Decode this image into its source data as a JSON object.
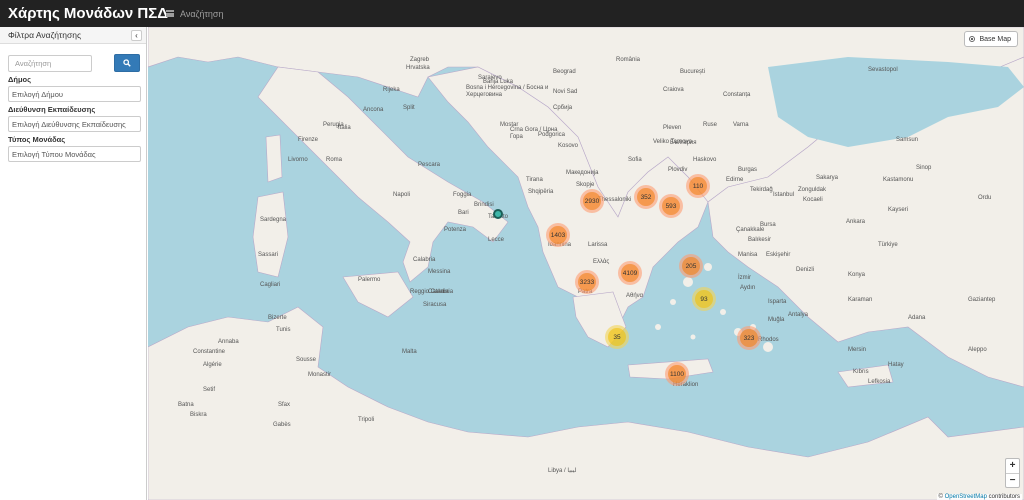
{
  "app": {
    "title": "Χάρτης Μονάδων ΠΣΔ",
    "nav_search": "Αναζήτηση"
  },
  "sidebar": {
    "header": "Φίλτρα Αναζήτησης",
    "search_placeholder": "Αναζήτηση",
    "filters": [
      {
        "label": "Δήμος",
        "value": "Επιλογή Δήμου"
      },
      {
        "label": "Διεύθυνση Εκπαίδευσης",
        "value": "Επιλογή Διεύθυνσης Εκπαίδευσης"
      },
      {
        "label": "Τύπος Μονάδας",
        "value": "Επιλογή Τύπου Μονάδας"
      }
    ]
  },
  "map": {
    "basemap_label": "Base Map",
    "attribution_prefix": "© ",
    "attribution_link": "OpenStreetMap",
    "attribution_suffix": " contributors",
    "zoom_in": "+",
    "zoom_out": "−",
    "clusters": [
      "2930",
      "352",
      "593",
      "110",
      "1403",
      "4109",
      "205",
      "3233",
      "93",
      "35",
      "323",
      "1100"
    ],
    "labels": [
      "Hrvatska",
      "Bosna i Hercegovina / Босна и Херцеговина",
      "Србија",
      "Crna Gora / Црна Гора",
      "Kosovo",
      "Shqipëria",
      "Македонија",
      "България",
      "București",
      "Sevastopol",
      "România",
      "Istanbul",
      "Türkiye",
      "Ankara",
      "Ελλάς",
      "Αθήνα",
      "Italia",
      "Napoli",
      "Roma",
      "Palermo",
      "Malta",
      "Tunis",
      "Algérie",
      "Libya / ليبيا",
      "Tripoli",
      "Kıbrıs",
      "Beograd",
      "Sarajevo",
      "Zagreb",
      "Bari",
      "Brindisi",
      "Taranto",
      "Potenza",
      "Bursa",
      "İzmir",
      "Konya",
      "Kayseri",
      "Antalya",
      "Isparta",
      "Sofia",
      "Skopje",
      "Tirana",
      "Plovdiv",
      "Varna",
      "Burgas",
      "Tekirdağ",
      "Samsun",
      "Ordu",
      "Sinop",
      "Kastamonu",
      "Sakarya",
      "Zonguldak",
      "Kocaeli",
      "Eskişehir",
      "Aydın",
      "Adana",
      "Gaziantep",
      "Sfax",
      "Sousse",
      "Monastir",
      "Constantine",
      "Annaba",
      "Setif",
      "Biskra",
      "Batna",
      "Bizerte",
      "Gabès",
      "Sardegna",
      "Cagliari",
      "Sassari",
      "Calabria",
      "Reggio Calabria",
      "Catania",
      "Messina",
      "Siracusa",
      "Lecce",
      "Foggia",
      "Pescara",
      "Ancona",
      "Perugia",
      "Firenze",
      "Livorno",
      "Split",
      "Rijeka",
      "Banja Luka",
      "Mostar",
      "Podgorica",
      "Thessaloniki",
      "Larissa",
      "Patra",
      "Ioannina",
      "Heraklion",
      "Rhodos",
      "Lefkosia",
      "Novi Sad",
      "Craiova",
      "Constanța",
      "Ruse",
      "Pleven",
      "Veliko Tarnovo",
      "Haskovo",
      "Edirne",
      "Çanakkale",
      "Balıkesir",
      "Manisa",
      "Denizli",
      "Muğla",
      "Karaman",
      "Mersin",
      "Hatay",
      "Aleppo"
    ]
  }
}
